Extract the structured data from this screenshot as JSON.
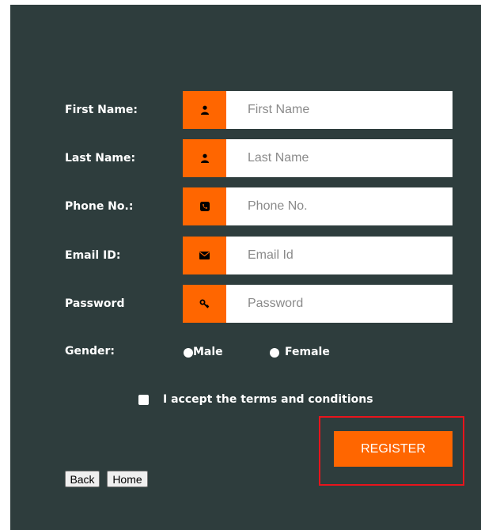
{
  "form": {
    "fields": [
      {
        "label": "First Name:",
        "placeholder": "First Name",
        "icon": "user-icon"
      },
      {
        "label": "Last Name:",
        "placeholder": "Last Name",
        "icon": "user-icon"
      },
      {
        "label": "Phone No.:",
        "placeholder": "Phone No.",
        "icon": "phone-icon"
      },
      {
        "label": "Email ID:",
        "placeholder": "Email Id",
        "icon": "envelope-icon"
      },
      {
        "label": "Password",
        "placeholder": "Password",
        "icon": "key-icon"
      }
    ],
    "gender": {
      "label": "Gender:",
      "options": [
        "Male",
        "Female"
      ]
    },
    "terms_label": "I accept the terms and conditions",
    "register_label": "REGISTER",
    "back_label": "Back",
    "home_label": "Home"
  },
  "colors": {
    "panel_bg": "#2e3d3d",
    "accent": "#ff6600",
    "highlight_border": "#e8141c"
  }
}
